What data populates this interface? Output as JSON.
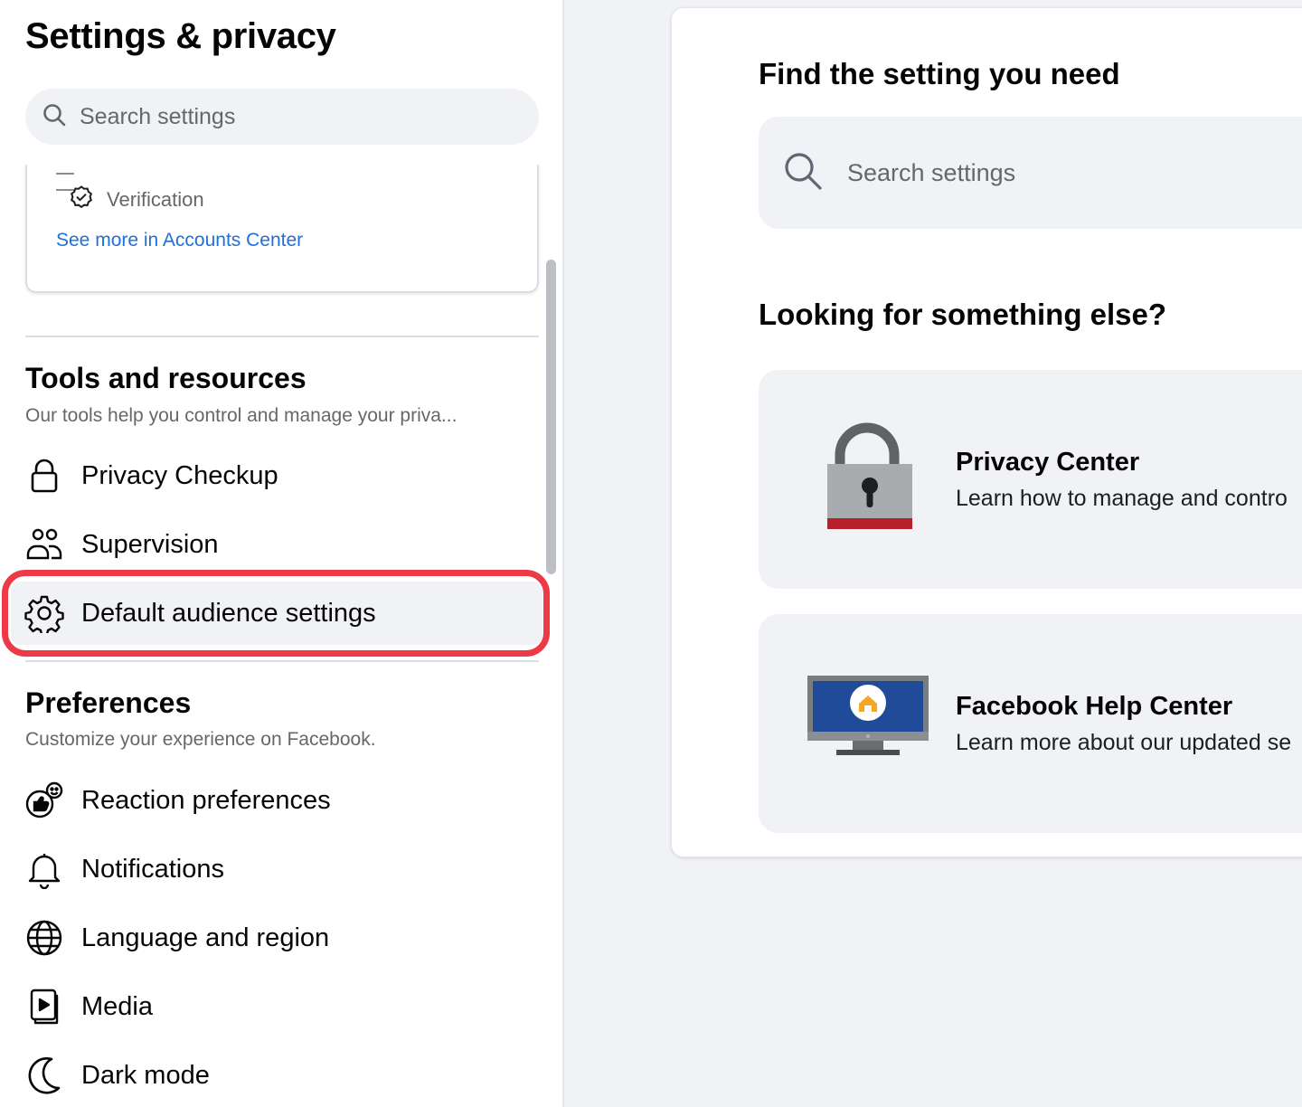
{
  "sidebar": {
    "title": "Settings & privacy",
    "search_placeholder": "Search settings",
    "accounts_center": {
      "verification_label": "Verification",
      "see_more_link": "See more in Accounts Center"
    },
    "tools": {
      "heading": "Tools and resources",
      "subtitle": "Our tools help you control and manage your priva...",
      "items": [
        {
          "label": "Privacy Checkup",
          "icon": "lock-icon"
        },
        {
          "label": "Supervision",
          "icon": "people-icon"
        },
        {
          "label": "Default audience settings",
          "icon": "gear-icon",
          "highlighted": true
        }
      ]
    },
    "preferences": {
      "heading": "Preferences",
      "subtitle": "Customize your experience on Facebook.",
      "items": [
        {
          "label": "Reaction preferences",
          "icon": "reaction-icon"
        },
        {
          "label": "Notifications",
          "icon": "bell-icon"
        },
        {
          "label": "Language and region",
          "icon": "globe-icon"
        },
        {
          "label": "Media",
          "icon": "media-icon"
        },
        {
          "label": "Dark mode",
          "icon": "moon-icon"
        }
      ]
    }
  },
  "main": {
    "find_heading": "Find the setting you need",
    "search_placeholder": "Search settings",
    "else_heading": "Looking for something else?",
    "resources": [
      {
        "title": "Privacy Center",
        "description": "Learn how to manage and contro",
        "icon": "padlock-illustration"
      },
      {
        "title": "Facebook Help Center",
        "description": "Learn more about our updated se",
        "icon": "monitor-home-illustration"
      }
    ]
  },
  "colors": {
    "link_blue": "#216fdb",
    "highlight_red": "#ec3a46",
    "background_gray": "#f0f2f5"
  }
}
